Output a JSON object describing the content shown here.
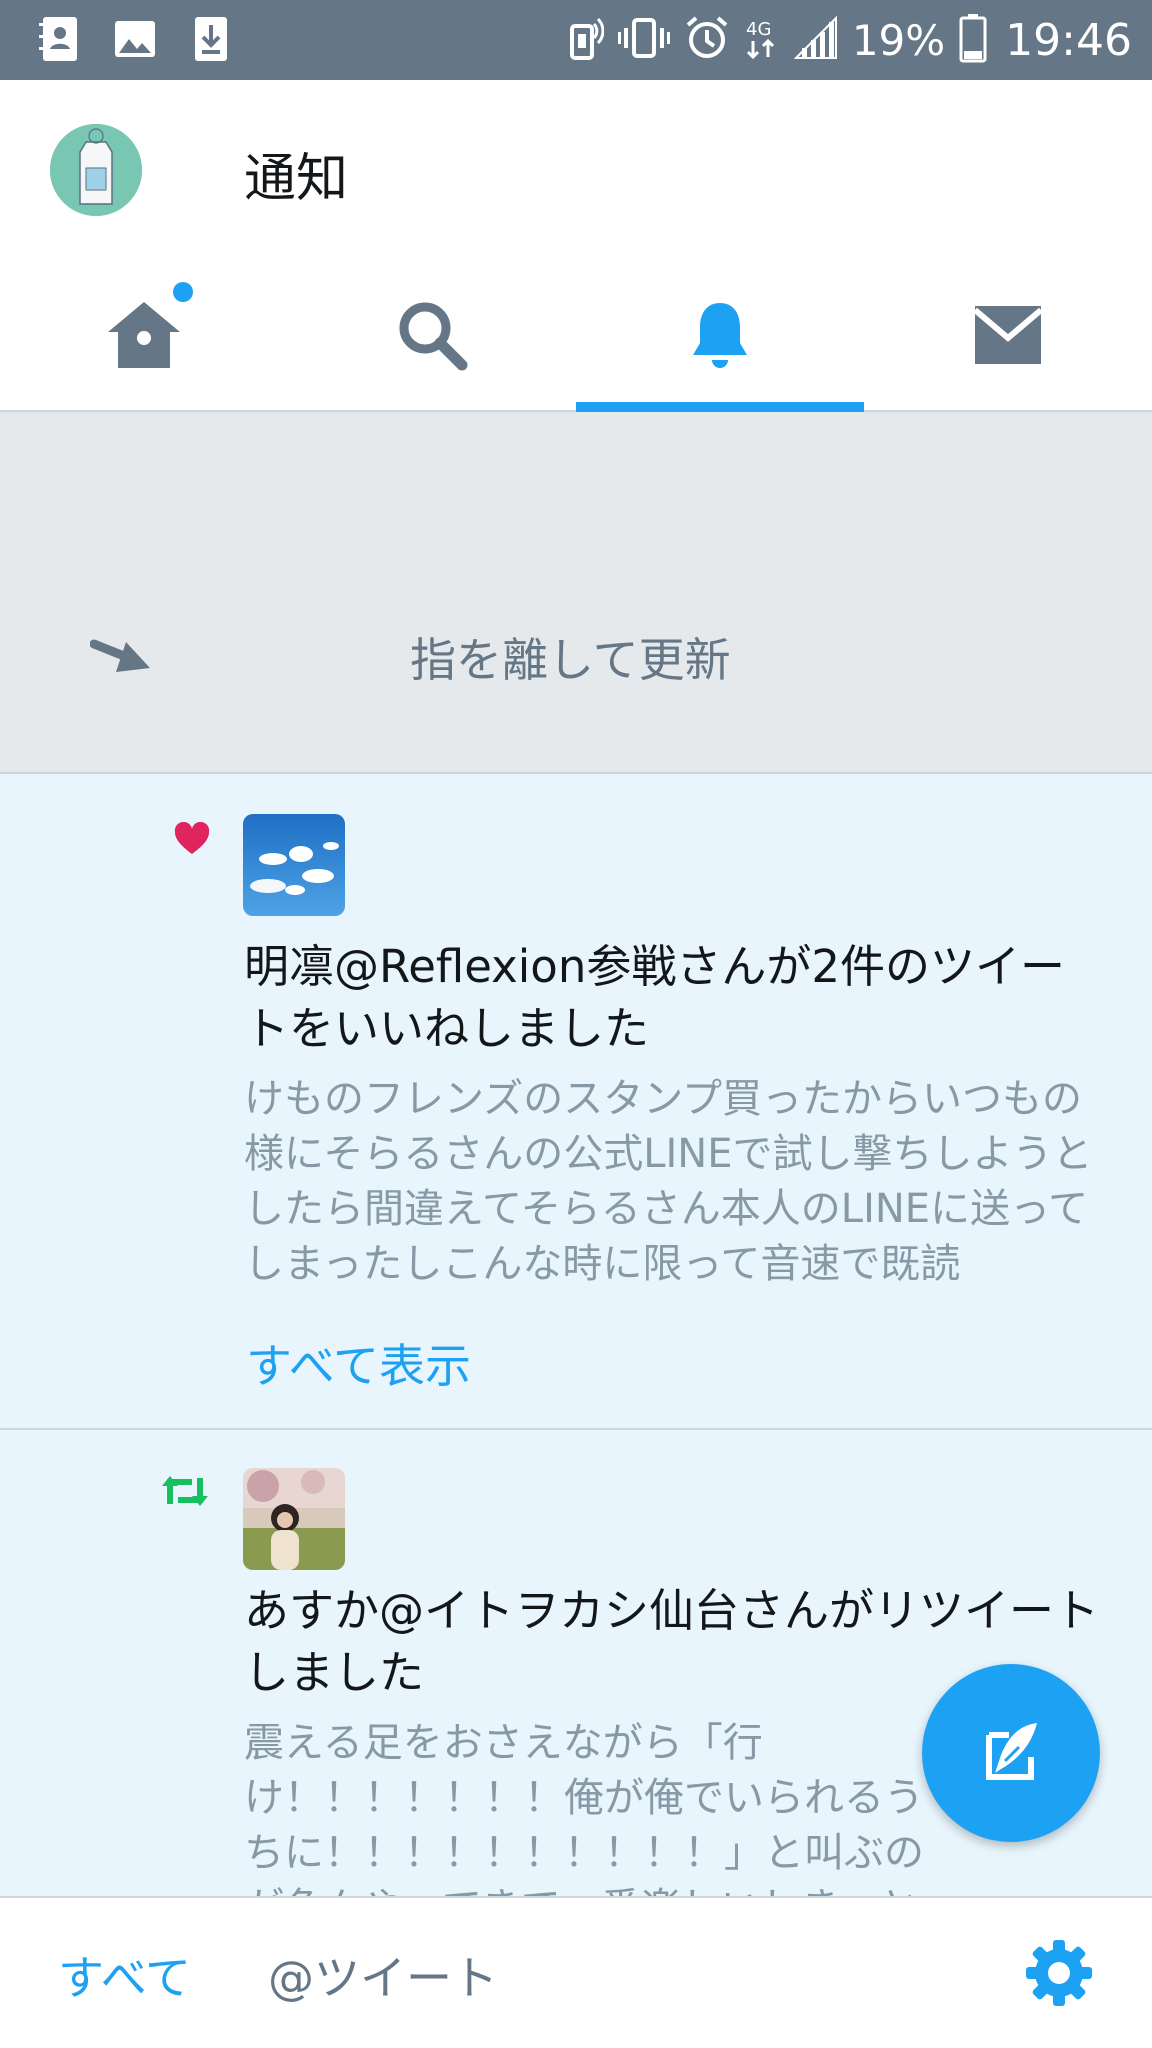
{
  "status_bar": {
    "battery": "19%",
    "time": "19:46",
    "network": "4G",
    "icons": [
      "contacts-icon",
      "image-icon",
      "download-icon",
      "nfc-icon",
      "vibrate-icon",
      "alarm-icon",
      "network-4g-icon",
      "signal-icon",
      "battery-icon"
    ]
  },
  "header": {
    "title": "通知"
  },
  "tabs": [
    {
      "name": "home-icon",
      "active": false
    },
    {
      "name": "search-icon",
      "active": false
    },
    {
      "name": "bell-icon",
      "active": true
    },
    {
      "name": "mail-icon",
      "active": false
    }
  ],
  "refresh": {
    "text": "指を離して更新"
  },
  "notifications": [
    {
      "type": "like",
      "icon": "heart-icon",
      "title": "明凛@Reflexion参戦さんが2件のツイートをいいねしました",
      "body": "けものフレンズのスタンプ買ったからいつもの様にそらるさんの公式LINEで試し撃ちしようとしたら間違えてそらるさん本人のLINEに送ってしまったしこんな時に限って音速で既読",
      "show_all": "すべて表示"
    },
    {
      "type": "retweet",
      "icon": "retweet-icon",
      "title": "あすか@イトヲカシ仙台さんがリツイートしました",
      "body": "震える足をおさえながら「行け！！！！！！！俺が俺でいられるうちに！！！！！！！！！！」と叫ぶのが色々やってきて一番楽しいしきっとみんなもそうなんじゃないかな"
    }
  ],
  "bottom_bar": {
    "filter_all": "すべて",
    "filter_mentions": "@ツイート"
  },
  "colors": {
    "accent": "#1da1f2",
    "status_bar": "#657786",
    "like": "#e0245e",
    "retweet": "#17bf63",
    "highlight_bg": "#e8f5fd"
  }
}
